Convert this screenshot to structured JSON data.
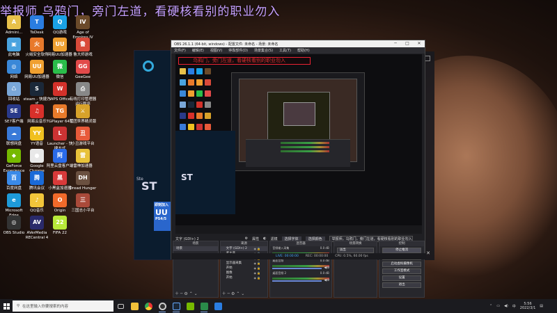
{
  "banner_text": "举报师 乌鸦门，旁门左道，看硬核看别的职业勿入",
  "desktop_icons": [
    {
      "label": "Admini...",
      "color": "#e8c14a",
      "glyph": "A"
    },
    {
      "label": "ToDesk",
      "color": "#2a7de1",
      "glyph": "T"
    },
    {
      "label": "QQ游戏",
      "color": "#1aa2e6",
      "glyph": "Q"
    },
    {
      "label": "Age of Empires IV",
      "color": "#6b4a2a",
      "glyph": "IV"
    },
    {
      "label": "此电脑",
      "color": "#4aa3df",
      "glyph": "▣"
    },
    {
      "label": "火绒安全软件",
      "color": "#e8792b",
      "glyph": "火"
    },
    {
      "label": "网易UU加速器",
      "color": "#f0a030",
      "glyph": "UU"
    },
    {
      "label": "鲁大师游戏",
      "color": "#d94a3a",
      "glyph": "鲁"
    },
    {
      "label": "网络",
      "color": "#3a88d8",
      "glyph": "◎"
    },
    {
      "label": "网易UU加速器",
      "color": "#f0a030",
      "glyph": "UU"
    },
    {
      "label": "微信",
      "color": "#2bbd4a",
      "glyph": "微"
    },
    {
      "label": "GeeGee",
      "color": "#e24a4a",
      "glyph": "GG"
    },
    {
      "label": "回收站",
      "color": "#7aa7d8",
      "glyph": "♺"
    },
    {
      "label": "steam - 快捷方式",
      "color": "#1b2838",
      "glyph": "S"
    },
    {
      "label": "WPS Office",
      "color": "#d3312a",
      "glyph": "W"
    },
    {
      "label": "有线打印管理器运行程序",
      "color": "#888888",
      "glyph": "⎙"
    },
    {
      "label": "SE7客户端",
      "color": "#2a3a8a",
      "glyph": "SE"
    },
    {
      "label": "网易云音乐",
      "color": "#d8302a",
      "glyph": "♫"
    },
    {
      "label": "TGPlayer 64位",
      "color": "#e87a2a",
      "glyph": "TG"
    },
    {
      "label": "军团世界精灵版",
      "color": "#d8a22a",
      "glyph": "⚔"
    },
    {
      "label": "联想网盘",
      "color": "#3a7ad8",
      "glyph": "☁"
    },
    {
      "label": "YY语音",
      "color": "#f0c020",
      "glyph": "YY"
    },
    {
      "label": "Launcher - 快捷方式",
      "color": "#cc3333",
      "glyph": "L"
    },
    {
      "label": "小丑游戏平台",
      "color": "#e85a3a",
      "glyph": "丑"
    },
    {
      "label": "GeForce Experience",
      "color": "#76b900",
      "glyph": "◆"
    },
    {
      "label": "Google Chrome",
      "color": "#e8e8e8",
      "glyph": "●"
    },
    {
      "label": "阿里云盘客户端",
      "color": "#2a6ae8",
      "glyph": "阿"
    },
    {
      "label": "雷神加速器",
      "color": "#e8c23a",
      "glyph": "雷"
    },
    {
      "label": "百度网盘",
      "color": "#3a8ae8",
      "glyph": "百"
    },
    {
      "label": "腾讯会议",
      "color": "#1a6ad8",
      "glyph": "腾"
    },
    {
      "label": "小黑盒加速器",
      "color": "#d83a3a",
      "glyph": "黑"
    },
    {
      "label": "Dread Hunger",
      "color": "#6a5040",
      "glyph": "DH"
    },
    {
      "label": "Microsoft Edge",
      "color": "#1e9ad8",
      "glyph": "e"
    },
    {
      "label": "QQ音乐",
      "color": "#f2c53a",
      "glyph": "♪"
    },
    {
      "label": "Origin",
      "color": "#f26a2a",
      "glyph": "O"
    },
    {
      "label": "三国志小平台",
      "color": "#aa4a3a",
      "glyph": "三"
    },
    {
      "label": "OBS Studio",
      "color": "#333333",
      "glyph": "◎"
    },
    {
      "label": "AVerMedia RECentral 4",
      "color": "#2a2a6a",
      "glyph": "AV"
    },
    {
      "label": "FIFA 22",
      "color": "#b8e83a",
      "glyph": "22"
    }
  ],
  "steam": {
    "big_text": "ST",
    "sub_text": "Ste",
    "promo_title": "即刻加入",
    "promo_uu": "UU",
    "promo_ps": "PS4/5"
  },
  "obs": {
    "title": "OBS 26.1.1 (64-bit, windows) - 配置文件: 未命名 - 场景: 未命名",
    "menu": [
      "文件(F)",
      "编辑(E)",
      "视图(V)",
      "停靠部件(D)",
      "场景集合(S)",
      "工具(T)",
      "帮助(H)"
    ],
    "preview_banner": "乌鸦门，旁门左道，看硬核看别的职业勿入",
    "status_row": {
      "source": "文字 (GDI+) 2",
      "props": "属性",
      "filters": "滤镜",
      "select_font": "选择字体",
      "select_color": "选择颜色",
      "text": "举报师，乌鸦门，旁门左道，看硬核看别的职业勿入"
    },
    "scenes_header": "场景",
    "scenes": [
      "场景"
    ],
    "sources_header": "来源",
    "sources": [
      "文字 (GDI+) 2",
      "老大开",
      "显示器采集 2",
      "显示器采集",
      "开始",
      "图像",
      "开始"
    ],
    "mixer_header": "混音器",
    "mixer": [
      {
        "name": "音频输入采集",
        "db": "0.0 dB"
      },
      {
        "name": "桌面音频",
        "db": "0.0 dB"
      },
      {
        "name": "桌面音频 2",
        "db": "0.0 dB"
      }
    ],
    "transitions_header": "场景转换",
    "transition_type": "淡出",
    "duration_label": "时长",
    "duration_value": "300 ms",
    "controls_header": "控制",
    "controls": [
      "停止推流",
      "开始录制",
      "启动虚拟摄像机",
      "工作室模式",
      "设置",
      "退出"
    ],
    "statusbar": {
      "live": "LIVE: 00:00:00",
      "rec": "REC: 00:00:00",
      "cpu": "CPU: 0.5%, 60.00 fps"
    }
  },
  "taskbar": {
    "search_placeholder": "在这里输入你要搜索的内容",
    "time": "5:56",
    "date": "2022/3/1"
  }
}
